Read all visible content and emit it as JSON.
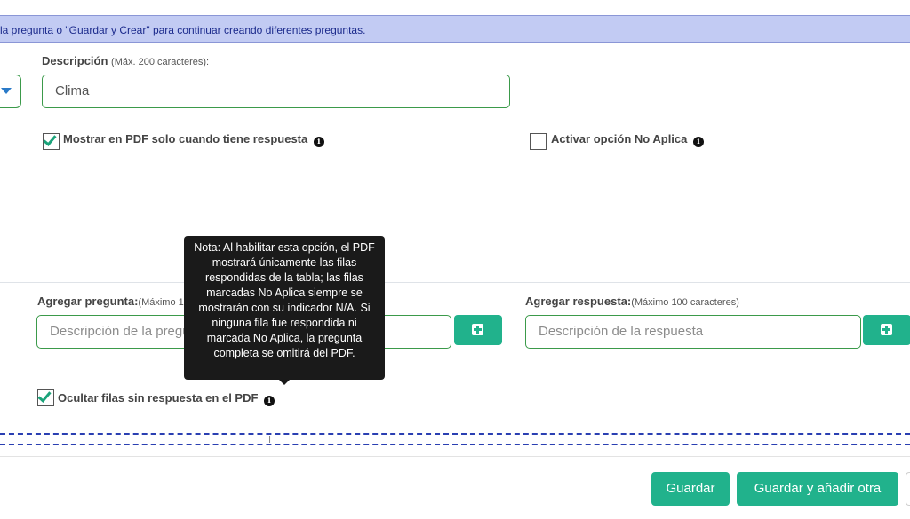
{
  "banner": {
    "text": "la pregunta o \"Guardar y Crear\" para continuar creando diferentes preguntas."
  },
  "description": {
    "label": "Descripción",
    "hint": "(Máx. 200 caracteres):",
    "value": "Clima"
  },
  "options": {
    "show_pdf_label": "Mostrar en PDF solo cuando tiene respuesta",
    "show_pdf_checked": true,
    "na_label": "Activar opción No Aplica",
    "na_checked": false
  },
  "add_question": {
    "label": "Agregar pregunta:",
    "hint": "(Máximo 1",
    "placeholder": "Descripción de la pregunta"
  },
  "add_answer": {
    "label": "Agregar respuesta:",
    "hint": "(Máximo 100 caracteres)",
    "placeholder": "Descripción de la respuesta"
  },
  "hide_rows": {
    "label": "Ocultar filas sin respuesta en el PDF",
    "checked": true
  },
  "tooltip": {
    "text": "Nota: Al habilitar esta opción, el PDF mostrará únicamente las filas respondidas de la tabla; las filas marcadas No Aplica siempre se mostrarán con su indicador N/A. Si ninguna fila fue respondida ni marcada No Aplica, la pregunta completa se omitirá del PDF."
  },
  "footer": {
    "save_label": "Guardar",
    "save_add_label": "Guardar y añadir otra"
  },
  "colors": {
    "accent": "#21b28c",
    "banner_bg": "#c2cbf3",
    "input_border": "#3b9a4a"
  },
  "icons": {
    "info": "info-circle-icon",
    "add": "plus-square-icon",
    "dropdown": "caret-down-icon"
  }
}
